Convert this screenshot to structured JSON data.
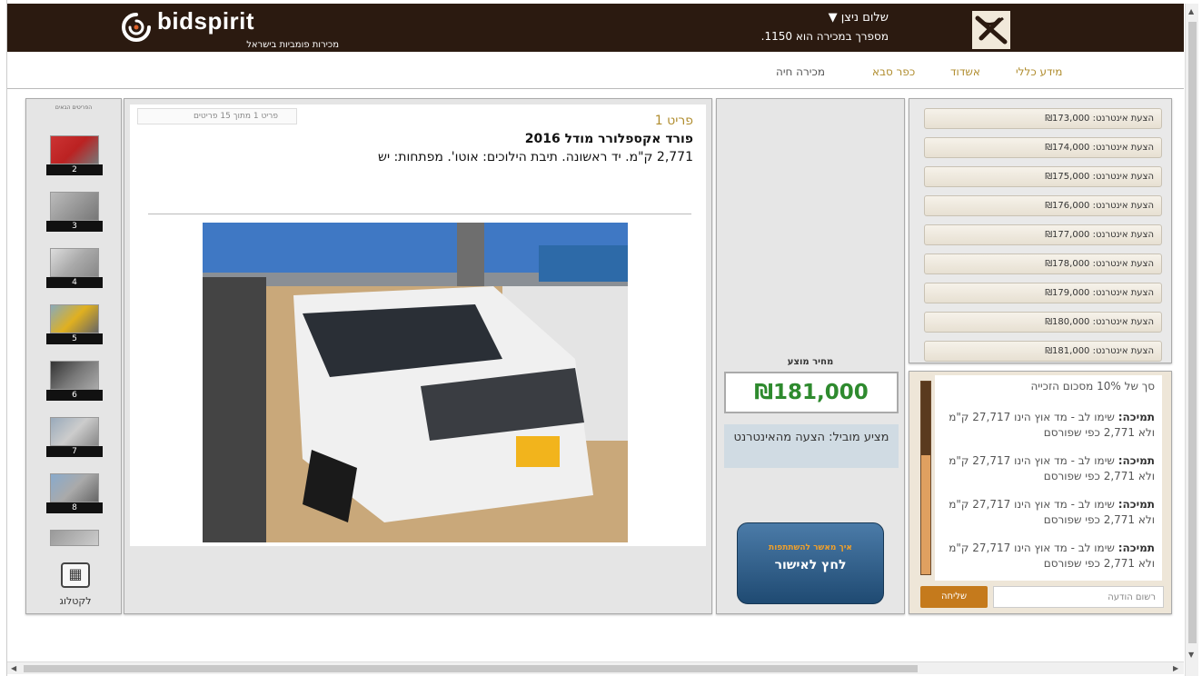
{
  "header": {
    "logo_text": "bidspirit",
    "logo_tagline": "מכירות פומביות בישראל",
    "user_name": "שלום ניצן ▼",
    "user_number": "מספרך במכירה הוא 1150."
  },
  "nav": {
    "general": "מידע כללי",
    "ashdod": "אשדוד",
    "kfar_saba": "כפר סבא",
    "live": "מכירה חיה"
  },
  "thumbs": {
    "title": "הפריטים הבאים",
    "numbers": [
      "2",
      "3",
      "4",
      "5",
      "6",
      "7",
      "8"
    ],
    "catalog_label": "לקטלוג"
  },
  "lot": {
    "pager": "פריט 1 מתוך 15 פריטים",
    "number": "פריט 1",
    "title": "פורד אקספלורר מודל 2016",
    "description": "2,771 ק\"מ. יד ראשונה. תיבת הילוכים: אוטו'. מפתחות: יש"
  },
  "bidding": {
    "price_label": "מחיר מוצע",
    "price": "₪181,000",
    "leader": "מציע מוביל: הצעה מהאינטרנט",
    "approve_sub": "איך מאשר להשתתפות",
    "approve_main": "לחץ לאישור",
    "accent": "#2e8a2e"
  },
  "bids": [
    "הצעת אינטרנט: ₪173,000",
    "הצעת אינטרנט: ₪174,000",
    "הצעת אינטרנט: ₪175,000",
    "הצעת אינטרנט: ₪176,000",
    "הצעת אינטרנט: ₪177,000",
    "הצעת אינטרנט: ₪178,000",
    "הצעת אינטרנט: ₪179,000",
    "הצעת אינטרנט: ₪180,000",
    "הצעת אינטרנט: ₪181,000"
  ],
  "chat": {
    "top_line": "סך של 10% מסכום הזכייה",
    "messages": [
      {
        "label": "תמיכה:",
        "text": "שימו לב - מד אוץ הינו 27,717 ק\"מ ולא 2,771 כפי שפורסם"
      },
      {
        "label": "תמיכה:",
        "text": "שימו לב - מד אוץ הינו 27,717 ק\"מ ולא 2,771 כפי שפורסם"
      },
      {
        "label": "תמיכה:",
        "text": "שימו לב - מד אוץ הינו 27,717 ק\"מ ולא 2,771 כפי שפורסם"
      },
      {
        "label": "תמיכה:",
        "text": "שימו לב - מד אוץ הינו 27,717 ק\"מ ולא 2,771 כפי שפורסם"
      }
    ],
    "input_placeholder": "רשום הודעה",
    "send_label": "שליחה",
    "progress": 0.62
  }
}
